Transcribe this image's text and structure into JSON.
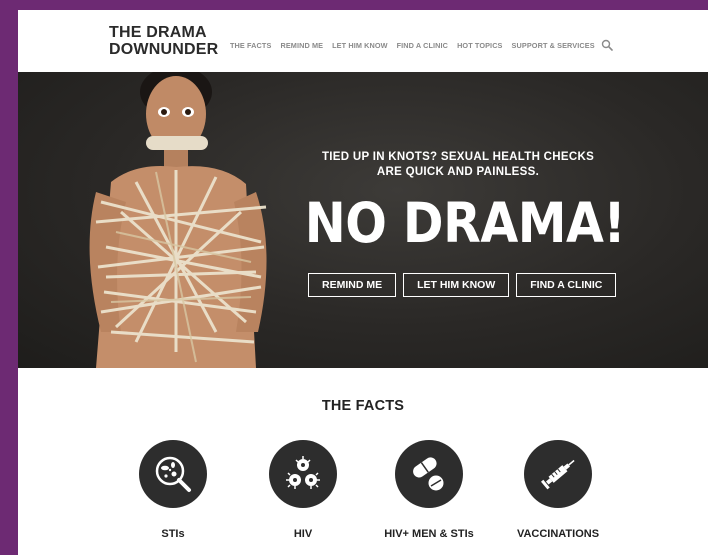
{
  "brand": {
    "line1": "THE DRAMA",
    "line2": "DOWNUNDER"
  },
  "nav": [
    {
      "label": "THE FACTS"
    },
    {
      "label": "REMIND ME"
    },
    {
      "label": "LET HIM KNOW"
    },
    {
      "label": "FIND A CLINIC"
    },
    {
      "label": "HOT TOPICS"
    },
    {
      "label": "SUPPORT & SERVICES"
    }
  ],
  "nav_search_icon": "search-icon",
  "hero": {
    "subheading": "TIED UP IN KNOTS? SEXUAL HEALTH CHECKS ARE QUICK AND PAINLESS.",
    "headline": "NO DRAMA!",
    "buttons": [
      {
        "label": "REMIND ME"
      },
      {
        "label": "LET HIM KNOW"
      },
      {
        "label": "FIND A CLINIC"
      }
    ]
  },
  "facts": {
    "title": "THE FACTS",
    "items": [
      {
        "label": "STIs",
        "icon": "microscope-icon"
      },
      {
        "label": "HIV",
        "icon": "virus-icon"
      },
      {
        "label": "HIV+ MEN & STIs",
        "icon": "pills-icon"
      },
      {
        "label": "VACCINATIONS",
        "icon": "syringe-icon"
      }
    ]
  },
  "colors": {
    "frame": "#6d2a73",
    "hero_bg": "#2a2826",
    "icon_circle": "#2d2d2d",
    "nav_text": "#8a8a8a"
  }
}
